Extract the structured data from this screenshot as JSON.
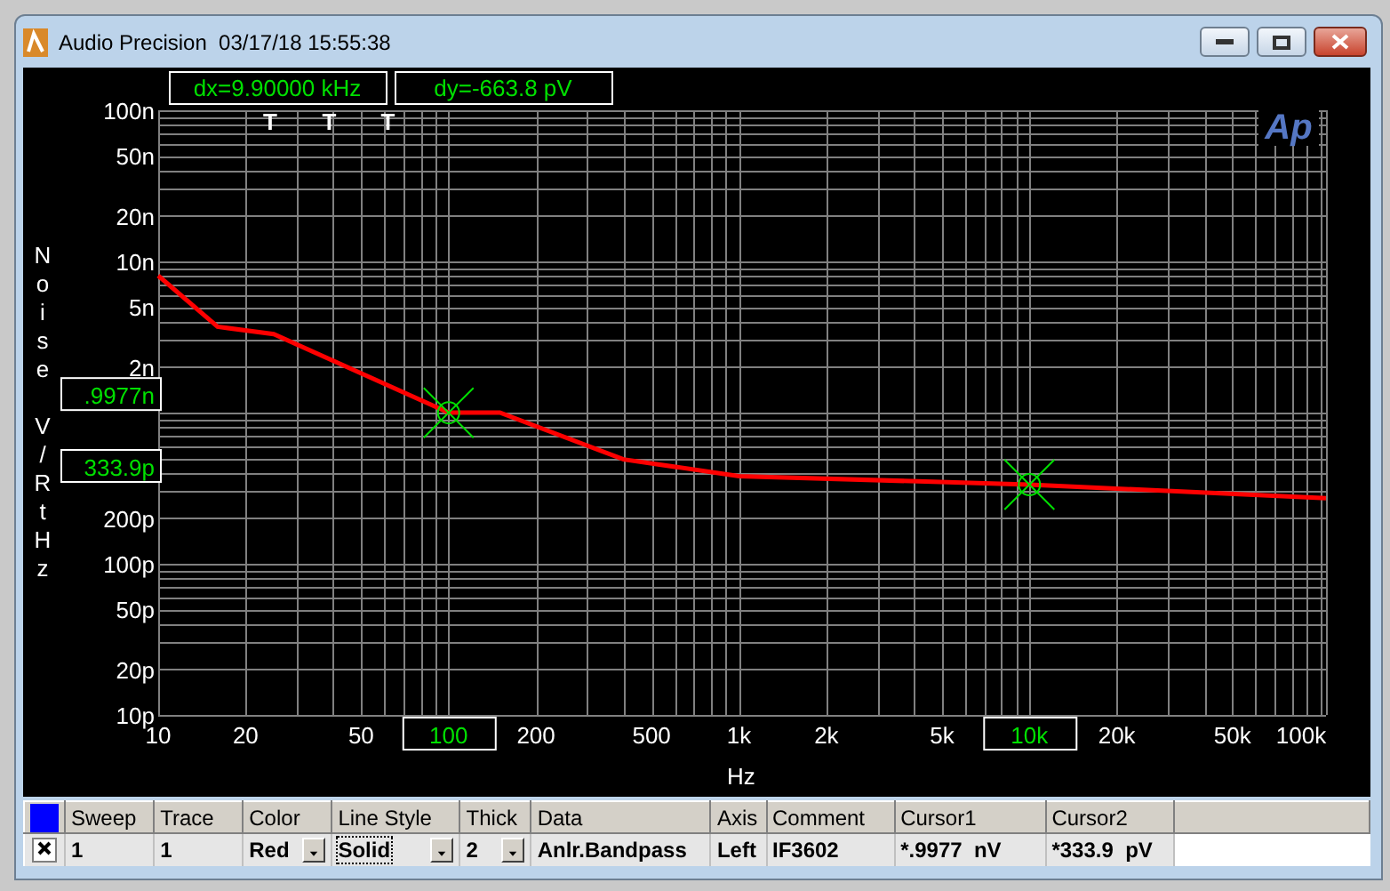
{
  "window": {
    "title": "Audio Precision  03/17/18 15:55:38"
  },
  "graph": {
    "logo": "Ap",
    "readouts": [
      {
        "kind": "dx",
        "text": "dx=9.90000 kHz"
      },
      {
        "kind": "dy",
        "text": "dy=-663.8  pV"
      }
    ],
    "y_axis_title": "Noise V/RtHz",
    "x_axis_title": "Hz",
    "y_labels": [
      "100n",
      "50n",
      "20n",
      "10n",
      "5n",
      "2n",
      "200p",
      "100p",
      "50p",
      "20p",
      "10p"
    ],
    "x_labels": [
      "10",
      "20",
      "50",
      "200",
      "500",
      "1k",
      "2k",
      "5k",
      "20k",
      "50k",
      "100k"
    ],
    "trigger_marks": [
      "T",
      "T",
      "T"
    ],
    "cursors": [
      {
        "x_label": "100",
        "y_label": ".9977n"
      },
      {
        "x_label": "10k",
        "y_label": "333.9p"
      }
    ]
  },
  "table": {
    "columns": [
      "Sweep",
      "Trace",
      "Color",
      "Line Style",
      "Thick",
      "Data",
      "Axis",
      "Comment",
      "Cursor1",
      "Cursor2"
    ],
    "rows": [
      {
        "checked": true,
        "cells": [
          {
            "kind": "text",
            "text": "1"
          },
          {
            "kind": "text",
            "text": "1"
          },
          {
            "kind": "dropdown",
            "text": "Red",
            "focused": false
          },
          {
            "kind": "dropdown",
            "text": "Solid",
            "focused": true
          },
          {
            "kind": "dropdown",
            "text": "2",
            "focused": false
          },
          {
            "kind": "text",
            "text": "Anlr.Bandpass"
          },
          {
            "kind": "text",
            "text": "Left"
          },
          {
            "kind": "text",
            "text": "IF3602"
          },
          {
            "kind": "text",
            "text": "*.9977  nV"
          },
          {
            "kind": "text",
            "text": "*333.9  pV"
          }
        ]
      }
    ]
  }
}
